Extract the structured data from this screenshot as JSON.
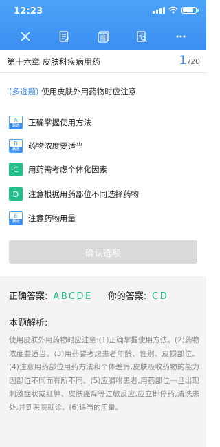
{
  "status_bar": {
    "time": "12:23"
  },
  "toolbar": {
    "icons": [
      "close-icon",
      "edit-notes-icon",
      "answer-sheet-icon",
      "search-document-icon",
      "more-icon"
    ]
  },
  "header": {
    "chapter_title": "第十六章 皮肤科疾病用药",
    "current_page": "1",
    "total_pages": "/20"
  },
  "question": {
    "type_label": "(多选题)",
    "text": "使用皮肤外用药物时应注意"
  },
  "options": [
    {
      "letter": "A",
      "badge_caption": "漏选",
      "text": "正确掌握使用方法",
      "state": "missed"
    },
    {
      "letter": "B",
      "badge_caption": "漏选",
      "text": "药物浓度要适当",
      "state": "missed"
    },
    {
      "letter": "C",
      "badge_caption": "",
      "text": "用药需考虑个体化因素",
      "state": "selected-correct"
    },
    {
      "letter": "D",
      "badge_caption": "",
      "text": "注意根据用药部位不同选择药物",
      "state": "selected-correct"
    },
    {
      "letter": "E",
      "badge_caption": "漏选",
      "text": "注意药物用量",
      "state": "missed"
    }
  ],
  "confirm_button": {
    "label": "确认选项"
  },
  "analysis": {
    "correct_label": "正确答案:",
    "correct_value": "ABCDE",
    "yours_label": "你的答案:",
    "yours_value": "CD",
    "title": "本题解析:",
    "body": "使用皮肤外用药物时应注意:(1)正确掌握使用方法。(2)药物浓度要适当。(3)用药要考虑患者年龄、性别、皮损部位。(4)注意用药部位用药方法和个体差异,皮肤吸收药物的能力因部位不同而有所不同。(5)应嘱咐患者,用药部位一旦出现刺激症状或红肿、皮肤瘙痒等过敏反应,应立即停药,清洗患处,并到医院就诊。(6)适当的用量。"
  },
  "colors": {
    "accent": "#3b8cf0",
    "correct_green": "#1fbf8f",
    "button_disabled": "#d9d9d9"
  }
}
